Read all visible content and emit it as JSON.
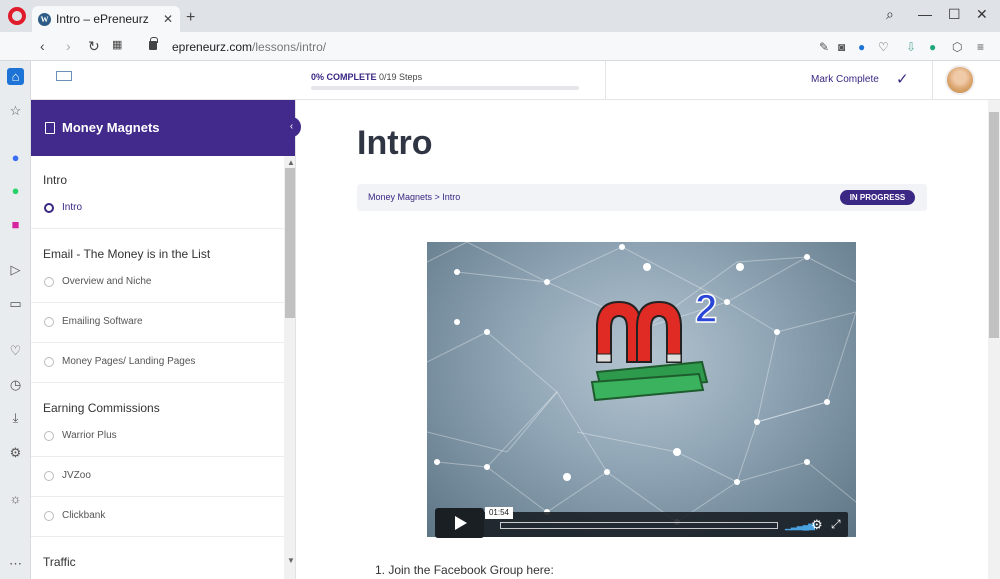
{
  "browser": {
    "tab_title": "Intro – ePreneurz",
    "url_host": "epreneurz.com",
    "url_path": "/lessons/intro/"
  },
  "header": {
    "progress_percent": "0% COMPLETE",
    "progress_steps": "0/19 Steps",
    "progress_fraction": 0,
    "mark_complete": "Mark Complete"
  },
  "course": {
    "title": "Money Magnets",
    "sections": [
      {
        "title": "Intro",
        "items": [
          "Intro"
        ]
      },
      {
        "title": "Email - The Money is in the List",
        "items": [
          "Overview and Niche",
          "Emailing Software",
          "Money Pages/ Landing Pages"
        ]
      },
      {
        "title": "Earning Commissions",
        "items": [
          "Warrior Plus",
          "JVZoo",
          "Clickbank"
        ]
      },
      {
        "title": "Traffic",
        "items": []
      }
    ]
  },
  "main": {
    "title": "Intro",
    "breadcrumb": "Money Magnets > Intro",
    "status": "IN PROGRESS",
    "video_time": "01:54",
    "step_1": "1. Join the Facebook Group here:"
  }
}
